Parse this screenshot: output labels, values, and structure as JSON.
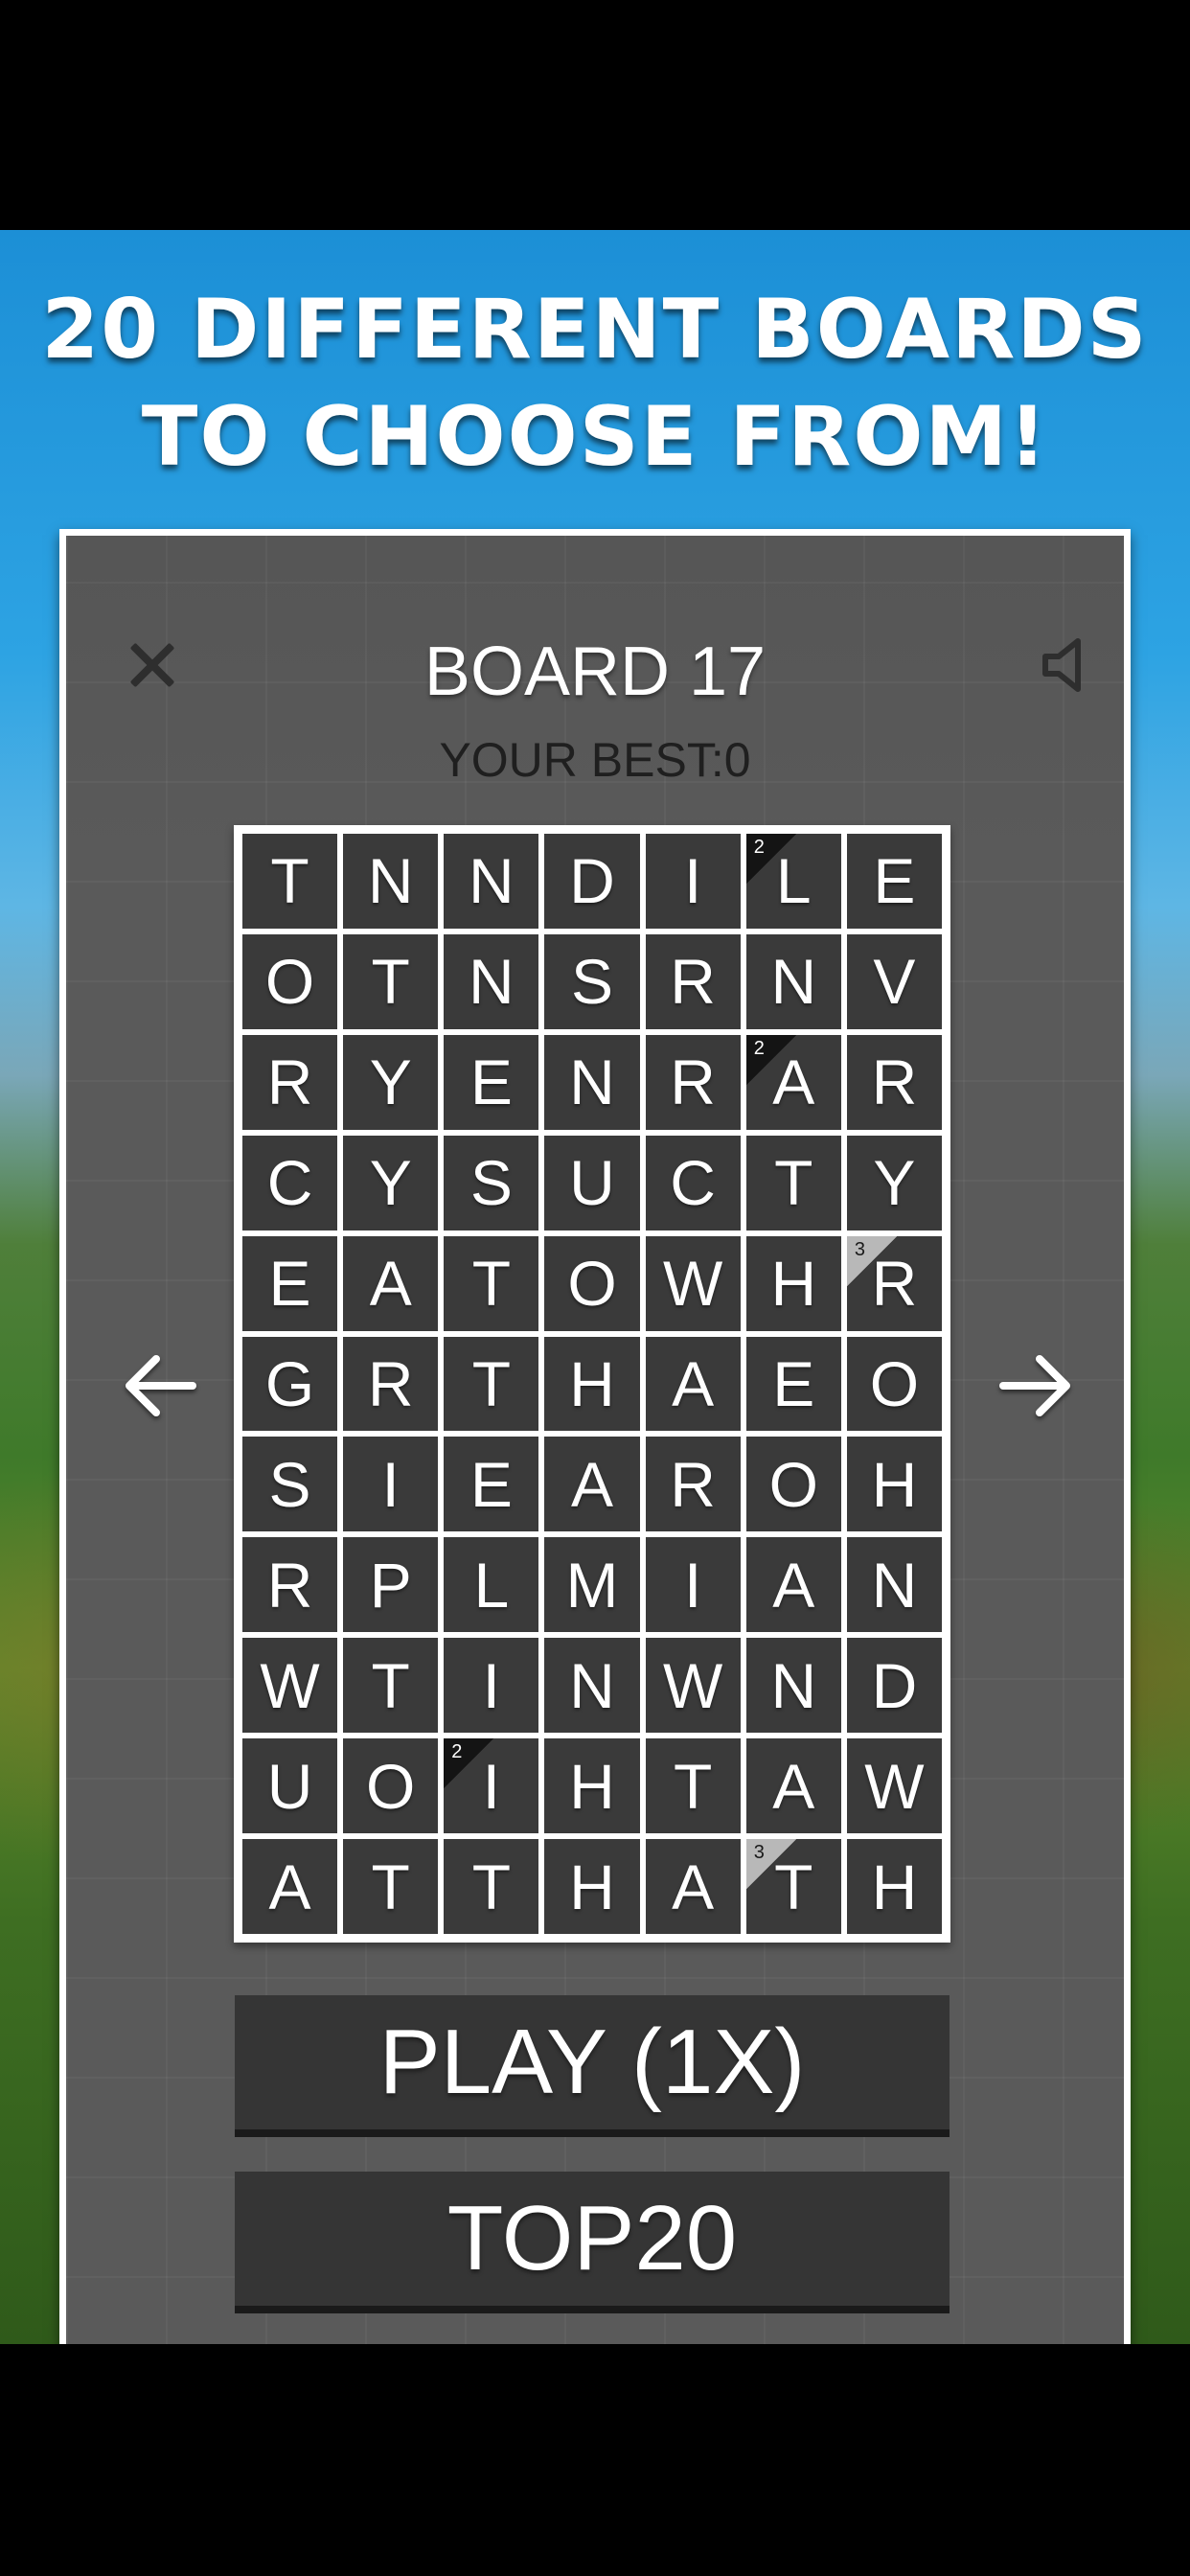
{
  "headline": {
    "line1": "20 DIFFERENT BOARDS",
    "line2": "TO CHOOSE FROM!"
  },
  "header": {
    "title": "BOARD 17",
    "best_label": "YOUR BEST:0",
    "close_icon": "close-icon",
    "sound_icon": "speaker-icon"
  },
  "nav": {
    "prev_icon": "arrow-left-icon",
    "next_icon": "arrow-right-icon"
  },
  "grid": {
    "rows": [
      [
        "T",
        "N",
        "N",
        "D",
        "I",
        "L",
        "E"
      ],
      [
        "O",
        "T",
        "N",
        "S",
        "R",
        "N",
        "V"
      ],
      [
        "R",
        "Y",
        "E",
        "N",
        "R",
        "A",
        "R"
      ],
      [
        "C",
        "Y",
        "S",
        "U",
        "C",
        "T",
        "Y"
      ],
      [
        "E",
        "A",
        "T",
        "O",
        "W",
        "H",
        "R"
      ],
      [
        "G",
        "R",
        "T",
        "H",
        "A",
        "E",
        "O"
      ],
      [
        "S",
        "I",
        "E",
        "A",
        "R",
        "O",
        "H"
      ],
      [
        "R",
        "P",
        "L",
        "M",
        "I",
        "A",
        "N"
      ],
      [
        "W",
        "T",
        "I",
        "N",
        "W",
        "N",
        "D"
      ],
      [
        "U",
        "O",
        "I",
        "H",
        "T",
        "A",
        "W"
      ],
      [
        "A",
        "T",
        "T",
        "H",
        "A",
        "T",
        "H"
      ]
    ],
    "bonuses": [
      {
        "row": 0,
        "col": 5,
        "label": "2",
        "style": "dark"
      },
      {
        "row": 2,
        "col": 5,
        "label": "2",
        "style": "dark"
      },
      {
        "row": 4,
        "col": 6,
        "label": "3",
        "style": "light"
      },
      {
        "row": 9,
        "col": 2,
        "label": "2",
        "style": "dark"
      },
      {
        "row": 10,
        "col": 5,
        "label": "3",
        "style": "light"
      }
    ]
  },
  "buttons": {
    "play_label": "PLAY (1X)",
    "top20_label": "TOP20"
  },
  "colors": {
    "panel": "#5a5a5a",
    "cell": "#3a3a3a",
    "button": "#353535",
    "sky": "#1c8fd6",
    "grass": "#3f7a2a"
  }
}
